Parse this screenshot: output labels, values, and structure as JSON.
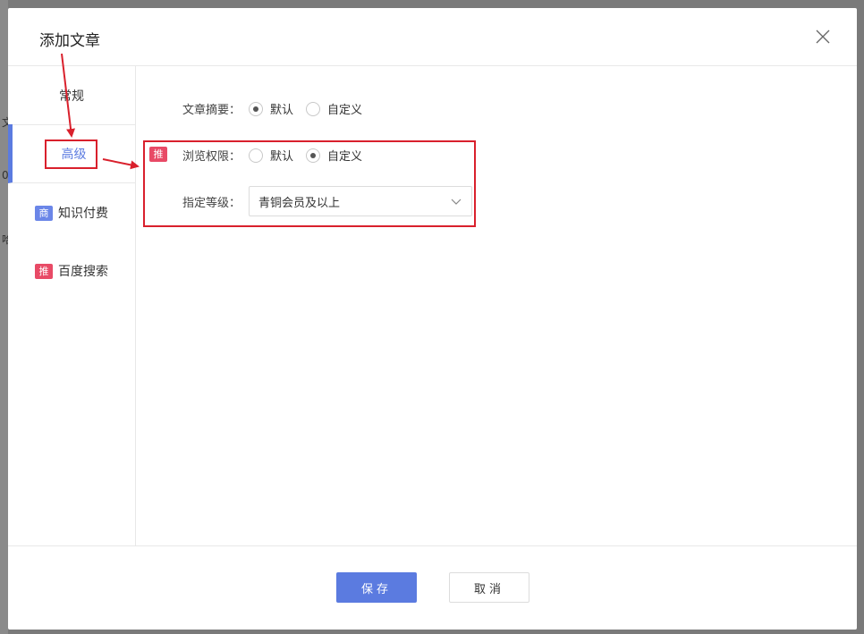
{
  "dialog": {
    "title": "添加文章",
    "close_icon": "close-icon"
  },
  "backdrop": {
    "glyphs": [
      "文",
      "0",
      "哈"
    ]
  },
  "side_nav": {
    "items": [
      {
        "label": "常规"
      },
      {
        "label": "高级",
        "active": true
      },
      {
        "label": "知识付费",
        "badge": "商"
      },
      {
        "label": "百度搜索",
        "badge": "推"
      }
    ]
  },
  "form": {
    "summary": {
      "label": "文章摘要：",
      "options": [
        "默认",
        "自定义"
      ],
      "selected": "默认"
    },
    "permission": {
      "badge": "推",
      "label": "浏览权限：",
      "options": [
        "默认",
        "自定义"
      ],
      "selected": "自定义"
    },
    "level": {
      "label": "指定等级：",
      "value": "青铜会员及以上"
    }
  },
  "footer": {
    "save_label": "保存",
    "cancel_label": "取消"
  },
  "colors": {
    "accent": "#5b7be0",
    "annotation_red": "#d9202c",
    "badge_tui": "#e84a66",
    "badge_shang": "#6b86e8"
  }
}
